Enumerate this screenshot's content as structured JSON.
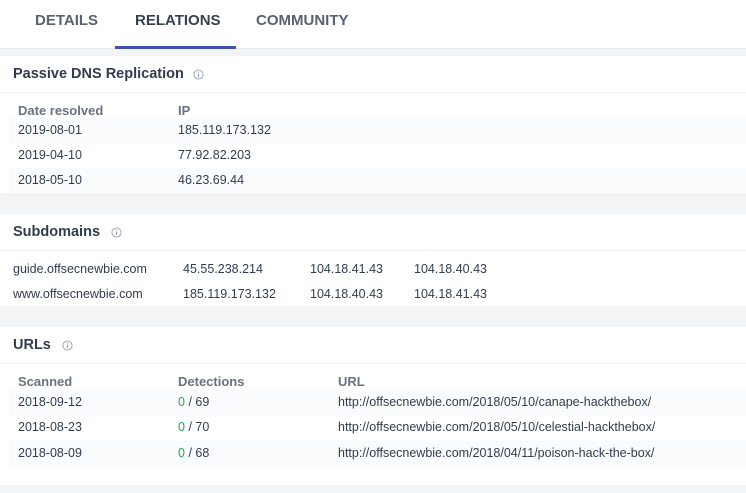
{
  "tabs": [
    {
      "label": "DETAILS",
      "active": false
    },
    {
      "label": "RELATIONS",
      "active": true
    },
    {
      "label": "COMMUNITY",
      "active": false
    }
  ],
  "colors": {
    "accent": "#3f51b5",
    "detection_ok": "#23a55a"
  },
  "passive_dns": {
    "title": "Passive DNS Replication",
    "icon": "info-icon",
    "columns": [
      "Date resolved",
      "IP"
    ],
    "rows": [
      {
        "date": "2019-08-01",
        "ip": "185.119.173.132"
      },
      {
        "date": "2019-04-10",
        "ip": "77.92.82.203"
      },
      {
        "date": "2018-05-10",
        "ip": "46.23.69.44"
      }
    ]
  },
  "subdomains": {
    "title": "Subdomains",
    "icon": "info-icon",
    "rows": [
      {
        "domain": "guide.offsecnewbie.com",
        "ips": [
          "45.55.238.214",
          "104.18.41.43",
          "104.18.40.43"
        ]
      },
      {
        "domain": "www.offsecnewbie.com",
        "ips": [
          "185.119.173.132",
          "104.18.40.43",
          "104.18.41.43"
        ]
      }
    ]
  },
  "urls": {
    "title": "URLs",
    "icon": "info-icon",
    "columns": [
      "Scanned",
      "Detections",
      "URL"
    ],
    "rows": [
      {
        "scanned": "2018-09-12",
        "positives": "0",
        "total": "/ 69",
        "url": "http://offsecnewbie.com/2018/05/10/canape-hackthebox/"
      },
      {
        "scanned": "2018-08-23",
        "positives": "0",
        "total": "/ 70",
        "url": "http://offsecnewbie.com/2018/05/10/celestial-hackthebox/"
      },
      {
        "scanned": "2018-08-09",
        "positives": "0",
        "total": "/ 68",
        "url": "http://offsecnewbie.com/2018/04/11/poison-hack-the-box/"
      }
    ]
  }
}
